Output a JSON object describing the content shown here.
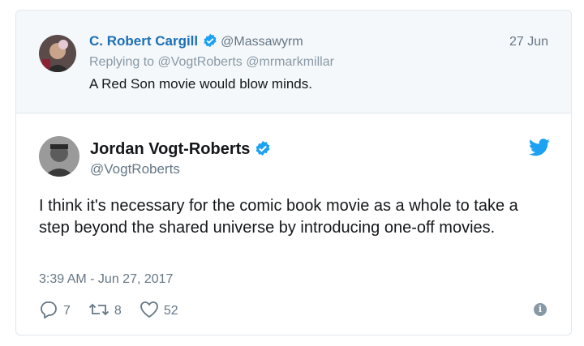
{
  "parent_tweet": {
    "author_name": "C. Robert Cargill",
    "handle": "@Massawyrm",
    "date": "27 Jun",
    "replying_prefix": "Replying to",
    "replying_to": [
      "@VogtRoberts",
      "@mrmarkmillar"
    ],
    "text": "A Red Son movie would blow minds.",
    "verified": true
  },
  "main_tweet": {
    "author_name": "Jordan Vogt-Roberts",
    "handle": "@VogtRoberts",
    "verified": true,
    "text": "I think it's necessary for the comic book movie as a whole to take a step beyond the shared universe by introducing one-off movies.",
    "timestamp": "3:39 AM - Jun 27, 2017"
  },
  "actions": {
    "replies": "7",
    "retweets": "8",
    "likes": "52"
  },
  "colors": {
    "link_blue": "#1c6fb8",
    "verified_blue": "#1da1f2",
    "muted_gray": "#657786",
    "parent_bg": "#f5f8fa"
  },
  "icons": [
    "verified-badge-icon",
    "twitter-bird-icon",
    "reply-icon",
    "retweet-icon",
    "like-icon",
    "info-icon"
  ]
}
